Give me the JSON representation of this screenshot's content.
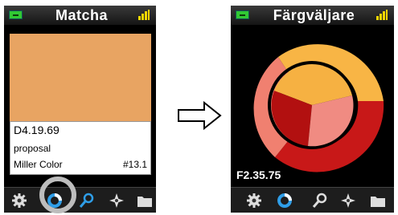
{
  "left": {
    "title": "Matcha",
    "swatch_color": "#e8a462",
    "code": "D4.19.69",
    "description": "proposal",
    "brand": "Miller Color",
    "number": "#13.1",
    "toolbar": [
      "settings-icon",
      "color-wheel-icon",
      "search-icon",
      "compass-icon",
      "folder-icon"
    ]
  },
  "right": {
    "title": "Färgväljare",
    "code": "F2.35.75",
    "toolbar": [
      "settings-icon",
      "color-wheel-icon",
      "search-icon",
      "compass-icon",
      "folder-icon"
    ]
  },
  "colors": {
    "battery": "#31c934",
    "signal": "#f4d700",
    "ring_outer_yellow": "#f8b545",
    "ring_outer_red": "#c81818",
    "ring_outer_salmon": "#f08070",
    "center_yellow": "#f6b142",
    "center_red": "#b21010",
    "center_pink": "#f08b82",
    "highlight": "#bdbdbd"
  }
}
